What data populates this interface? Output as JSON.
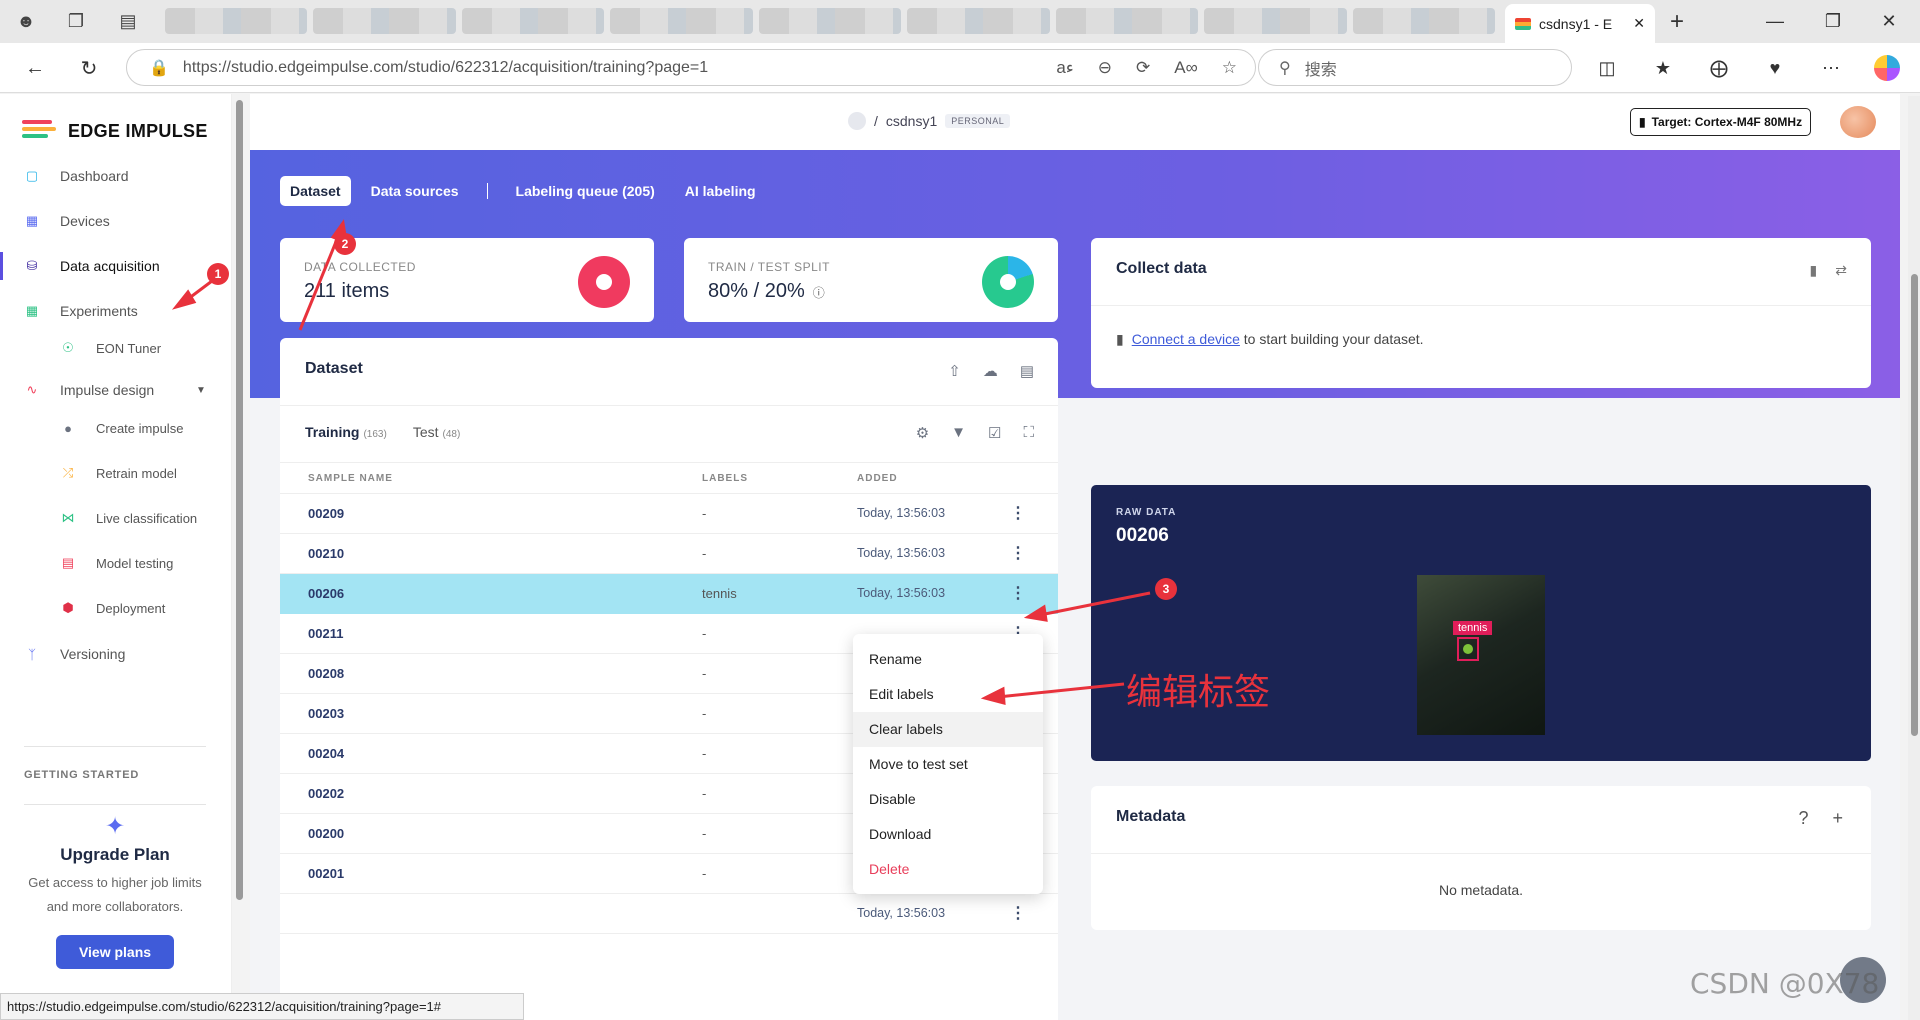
{
  "browser": {
    "active_tab_title": "csdnsy1 - E",
    "url": "https://studio.edgeimpulse.com/studio/622312/acquisition/training?page=1",
    "search_placeholder": "搜索",
    "status_url": "https://studio.edgeimpulse.com/studio/622312/acquisition/training?page=1#"
  },
  "sidebar": {
    "brand": "EDGE IMPULSE",
    "items": [
      {
        "label": "Dashboard",
        "icon": "monitor-icon"
      },
      {
        "label": "Devices",
        "icon": "chip-icon"
      },
      {
        "label": "Data acquisition",
        "icon": "database-icon"
      },
      {
        "label": "Experiments",
        "icon": "grid-icon"
      },
      {
        "label": "EON Tuner",
        "icon": "tuner-icon"
      },
      {
        "label": "Impulse design",
        "icon": "pulse-icon"
      },
      {
        "label": "Create impulse",
        "icon": "dot-icon"
      },
      {
        "label": "Retrain model",
        "icon": "shuffle-icon"
      },
      {
        "label": "Live classification",
        "icon": "tree-icon"
      },
      {
        "label": "Model testing",
        "icon": "clipboard-icon"
      },
      {
        "label": "Deployment",
        "icon": "cube-icon"
      },
      {
        "label": "Versioning",
        "icon": "branch-icon"
      }
    ],
    "getting_started": "GETTING STARTED",
    "upgrade": {
      "title": "Upgrade Plan",
      "text": "Get access to higher job limits and more collaborators.",
      "button": "View plans"
    }
  },
  "topbar": {
    "project": "csdnsy1",
    "badge": "PERSONAL",
    "target": "Target: Cortex-M4F 80MHz"
  },
  "tabs": [
    "Dataset",
    "Data sources",
    "Labeling queue (205)",
    "AI labeling"
  ],
  "stats": {
    "collected_label": "DATA COLLECTED",
    "collected_value": "211 items",
    "split_label": "TRAIN / TEST SPLIT",
    "split_value": "80% / 20%",
    "train_fraction": 0.8,
    "colors": {
      "collected": "#f03a5f",
      "train": "#27c98f",
      "test": "#2bb5e8"
    }
  },
  "dataset": {
    "title": "Dataset",
    "training_label": "Training",
    "training_count": "(163)",
    "test_label": "Test",
    "test_count": "(48)",
    "columns": [
      "SAMPLE NAME",
      "LABELS",
      "ADDED"
    ],
    "rows": [
      {
        "name": "00209",
        "label": "-",
        "added": "Today, 13:56:03"
      },
      {
        "name": "00210",
        "label": "-",
        "added": "Today, 13:56:03"
      },
      {
        "name": "00206",
        "label": "tennis",
        "added": "Today, 13:56:03"
      },
      {
        "name": "00211",
        "label": "-",
        "added": ""
      },
      {
        "name": "00208",
        "label": "-",
        "added": ""
      },
      {
        "name": "00203",
        "label": "-",
        "added": ""
      },
      {
        "name": "00204",
        "label": "-",
        "added": ""
      },
      {
        "name": "00202",
        "label": "-",
        "added": ""
      },
      {
        "name": "00200",
        "label": "-",
        "added": "Today, 13:56:03"
      },
      {
        "name": "00201",
        "label": "-",
        "added": "Today, 13:56:03"
      },
      {
        "name": "",
        "label": "",
        "added": "Today, 13:56:03"
      }
    ]
  },
  "context_menu": [
    "Rename",
    "Edit labels",
    "Clear labels",
    "Move to test set",
    "Disable",
    "Download",
    "Delete"
  ],
  "collect": {
    "title": "Collect data",
    "link": "Connect a device",
    "text": " to start building your dataset."
  },
  "raw": {
    "label": "RAW DATA",
    "value": "00206",
    "bbox_label": "tennis"
  },
  "metadata": {
    "title": "Metadata",
    "empty": "No metadata."
  },
  "annotations": {
    "badges": [
      "1",
      "2",
      "3"
    ],
    "note": "编辑标签",
    "color": "#e8323c"
  },
  "watermark": "CSDN @0X78"
}
